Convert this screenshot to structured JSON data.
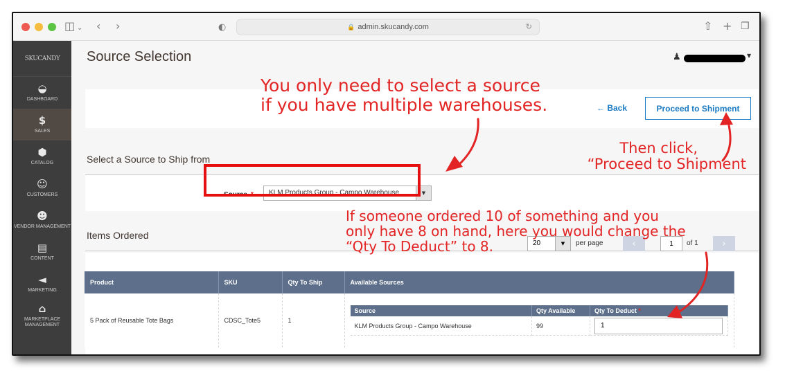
{
  "browser": {
    "url": "admin.skucandy.com"
  },
  "sidebar": {
    "logo": "SKUCANDY",
    "items": [
      {
        "label": "Dashboard",
        "icon": "dashboard-icon",
        "glyph": "◒"
      },
      {
        "label": "Sales",
        "icon": "dollar-icon",
        "glyph": "$"
      },
      {
        "label": "Catalog",
        "icon": "catalog-box-icon",
        "glyph": "⬢"
      },
      {
        "label": "Customers",
        "icon": "person-icon",
        "glyph": "☺"
      },
      {
        "label": "Vendor Management",
        "icon": "vendors-icon",
        "glyph": "☻"
      },
      {
        "label": "Content",
        "icon": "content-layout-icon",
        "glyph": "▤"
      },
      {
        "label": "Marketing",
        "icon": "megaphone-icon",
        "glyph": "◄"
      },
      {
        "label": "Marketplace Management",
        "icon": "marketplace-icon",
        "glyph": "⌂"
      }
    ],
    "active_index": 1
  },
  "header": {
    "page_title": "Source Selection"
  },
  "actions": {
    "back_label": "← Back",
    "proceed_label": "Proceed to Shipment"
  },
  "source_section": {
    "title": "Select a Source to Ship from",
    "field_label": "Source",
    "required_mark": "*",
    "selected_value": "KLM Products Group - Campo Warehouse"
  },
  "items_section": {
    "title": "Items Ordered",
    "per_page_value": "20",
    "per_page_label": "per page",
    "current_page": "1",
    "total_pages_label": "of 1",
    "columns": [
      "Product",
      "SKU",
      "Qty To Ship",
      "Available Sources"
    ],
    "rows": [
      {
        "product": "5 Pack of Reusable Tote Bags",
        "sku": "CDSC_Tote5",
        "qty_to_ship": "1",
        "sources_columns": [
          "Source",
          "Qty Available",
          "Qty To Deduct"
        ],
        "sources": [
          {
            "source": "KLM Products Group - Campo Warehouse",
            "qty_available": "99",
            "qty_to_deduct": "1"
          }
        ]
      }
    ]
  },
  "annotations": {
    "top_line1": "You only need to select a source",
    "top_line2": "if you have multiple warehouses.",
    "right_line1": "Then click,",
    "right_line2": "“Proceed to Shipment",
    "mid_line1": "If someone ordered 10 of something and you",
    "mid_line2": "only have 8 on hand, here you would change the",
    "mid_line3": "“Qty To Deduct” to 8.",
    "color": "#e22424"
  }
}
